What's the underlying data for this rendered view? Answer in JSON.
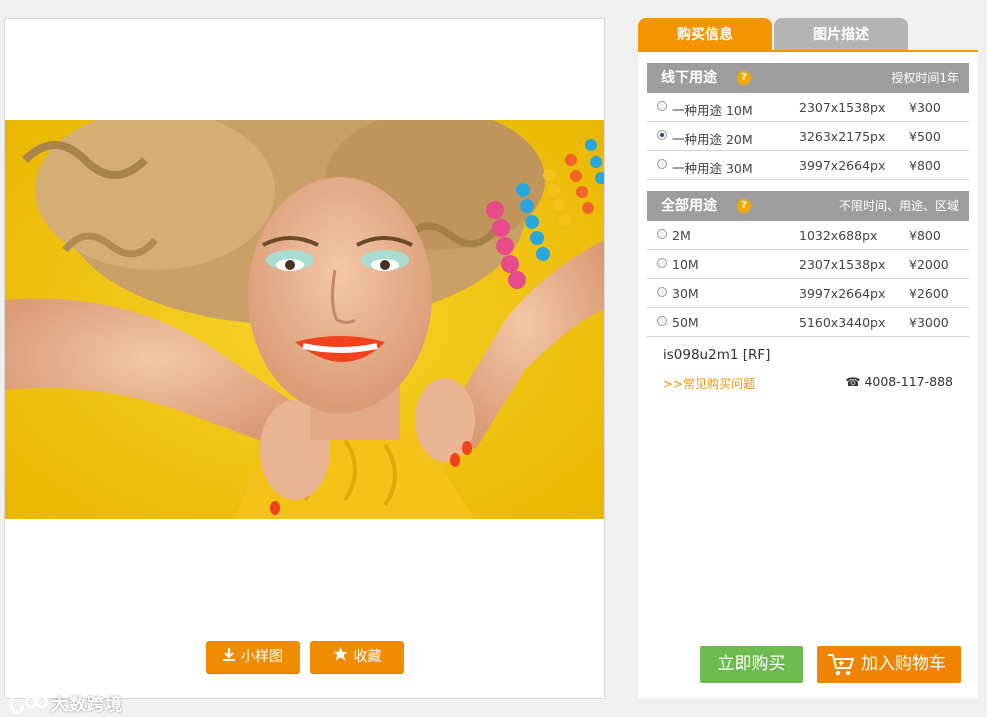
{
  "image_panel": {
    "buttons": [
      {
        "label": "小样图",
        "icon": "download-icon"
      },
      {
        "label": "收藏",
        "icon": "star-icon"
      }
    ],
    "watermark": "大数跨境"
  },
  "tabs": [
    {
      "label": "购买信息",
      "active": true
    },
    {
      "label": "图片描述",
      "active": false
    }
  ],
  "sections": [
    {
      "title": "线下用途",
      "help_icon": "?",
      "note": "授权时间1年",
      "options": [
        {
          "name": "一种用途 10M",
          "dimensions": "2307x1538px",
          "price": "¥300",
          "selected": false
        },
        {
          "name": "一种用途 20M",
          "dimensions": "3263x2175px",
          "price": "¥500",
          "selected": true
        },
        {
          "name": "一种用途 30M",
          "dimensions": "3997x2664px",
          "price": "¥800",
          "selected": false
        }
      ]
    },
    {
      "title": "全部用途",
      "help_icon": "?",
      "note": "不限时间、用途、区域",
      "options": [
        {
          "name": "2M",
          "dimensions": "1032x688px",
          "price": "¥800",
          "selected": false
        },
        {
          "name": "10M",
          "dimensions": "2307x1538px",
          "price": "¥2000",
          "selected": false
        },
        {
          "name": "30M",
          "dimensions": "3997x2664px",
          "price": "¥2600",
          "selected": false
        },
        {
          "name": "50M",
          "dimensions": "5160x3440px",
          "price": "¥3000",
          "selected": false
        }
      ]
    }
  ],
  "image_id": "is098u2m1 [RF]",
  "faq_link": ">>常见购买问题",
  "hotline": {
    "icon": "☎",
    "number": "4008-117-888"
  },
  "actions": {
    "buy_now": "立即购买",
    "add_to_cart": "加入购物车"
  },
  "colors": {
    "accent": "#f39400",
    "buy_green": "#6dbb4e",
    "cart_orange": "#f08400",
    "header_gray": "#9d9d9d",
    "photo_background": "#f2c20e"
  }
}
